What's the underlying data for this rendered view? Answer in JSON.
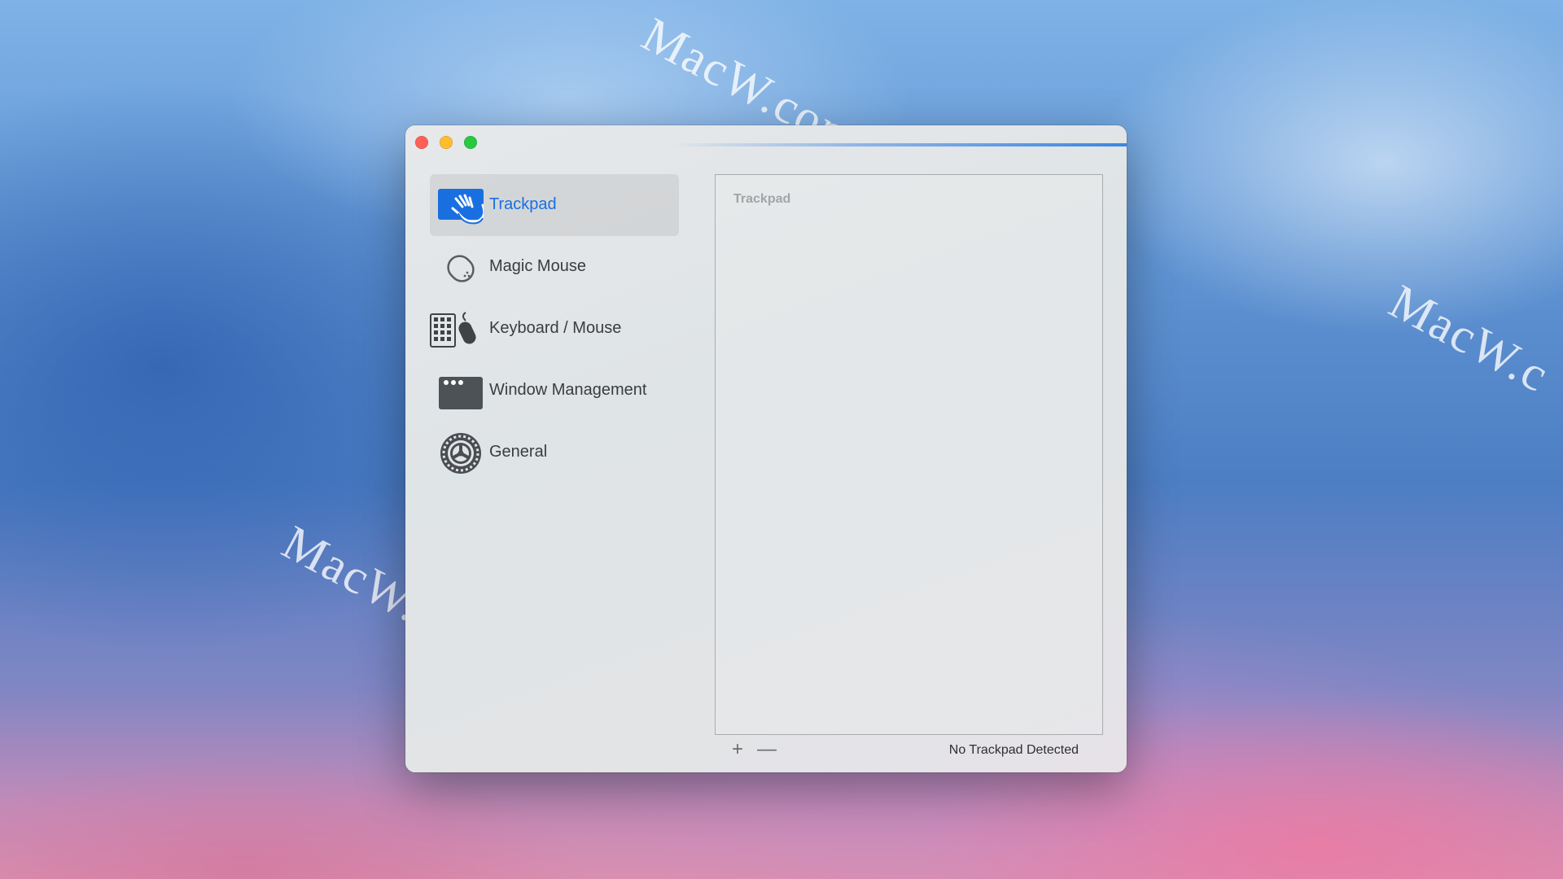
{
  "watermark": {
    "text_a": "MacW.com",
    "text_b": "MacW.com",
    "text_c": "MacW.c"
  },
  "window": {
    "titlebar": {
      "close_color": "#fe5f57",
      "minimize_color": "#febc2e",
      "maximize_color": "#28c840"
    },
    "sidebar": {
      "items": [
        {
          "label": "Trackpad",
          "icon": "trackpad-hand-icon",
          "selected": true
        },
        {
          "label": "Magic Mouse",
          "icon": "magic-mouse-icon",
          "selected": false
        },
        {
          "label": "Keyboard / Mouse",
          "icon": "keyboard-mouse-icon",
          "selected": false
        },
        {
          "label": "Window Management",
          "icon": "window-icon",
          "selected": false
        },
        {
          "label": "General",
          "icon": "gear-icon",
          "selected": false
        }
      ]
    },
    "panel": {
      "title": "Trackpad"
    },
    "bottom_bar": {
      "add_label": "+",
      "remove_label": "—",
      "status": "No Trackpad Detected"
    },
    "accent_color": "#1a6fe0"
  }
}
